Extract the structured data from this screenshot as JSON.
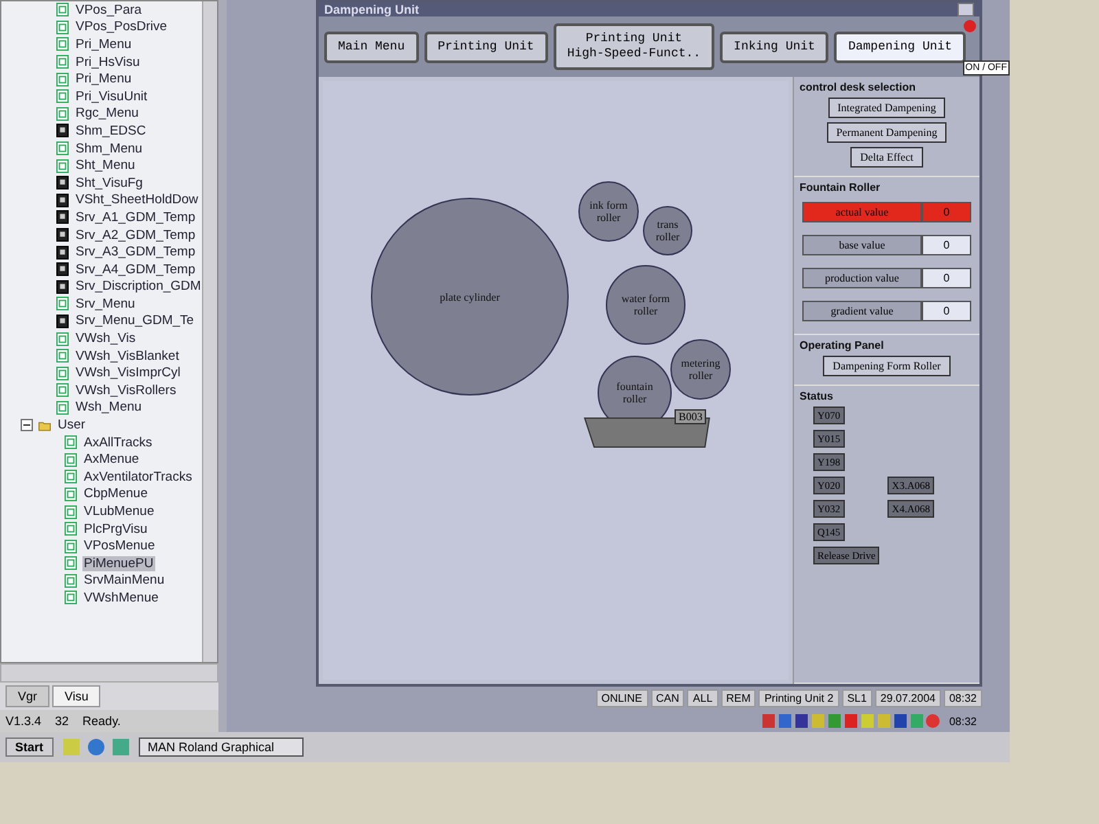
{
  "tree": {
    "items": [
      {
        "label": "VPos_Para",
        "kind": "doc",
        "selected": false
      },
      {
        "label": "VPos_PosDrive",
        "kind": "doc",
        "selected": false
      },
      {
        "label": "Pri_Menu",
        "kind": "doc",
        "selected": false
      },
      {
        "label": "Pri_HsVisu",
        "kind": "doc",
        "selected": false
      },
      {
        "label": "Pri_Menu",
        "kind": "doc",
        "selected": false
      },
      {
        "label": "Pri_VisuUnit",
        "kind": "doc",
        "selected": false
      },
      {
        "label": "Rgc_Menu",
        "kind": "doc",
        "selected": false
      },
      {
        "label": "Shm_EDSC",
        "kind": "module",
        "selected": false
      },
      {
        "label": "Shm_Menu",
        "kind": "doc",
        "selected": false
      },
      {
        "label": "Sht_Menu",
        "kind": "doc",
        "selected": false
      },
      {
        "label": "Sht_VisuFg",
        "kind": "module",
        "selected": false
      },
      {
        "label": "VSht_SheetHoldDow",
        "kind": "module",
        "selected": false
      },
      {
        "label": "Srv_A1_GDM_Temp",
        "kind": "module",
        "selected": false
      },
      {
        "label": "Srv_A2_GDM_Temp",
        "kind": "module",
        "selected": false
      },
      {
        "label": "Srv_A3_GDM_Temp",
        "kind": "module",
        "selected": false
      },
      {
        "label": "Srv_A4_GDM_Temp",
        "kind": "module",
        "selected": false
      },
      {
        "label": "Srv_Discription_GDM",
        "kind": "module",
        "selected": false
      },
      {
        "label": "Srv_Menu",
        "kind": "doc",
        "selected": false
      },
      {
        "label": "Srv_Menu_GDM_Te",
        "kind": "module",
        "selected": false
      },
      {
        "label": "VWsh_Vis",
        "kind": "doc",
        "selected": false
      },
      {
        "label": "VWsh_VisBlanket",
        "kind": "doc",
        "selected": false
      },
      {
        "label": "VWsh_VisImprCyl",
        "kind": "doc",
        "selected": false
      },
      {
        "label": "VWsh_VisRollers",
        "kind": "doc",
        "selected": false
      },
      {
        "label": "Wsh_Menu",
        "kind": "doc",
        "selected": false
      },
      {
        "label": "User",
        "kind": "folder",
        "expanded": true,
        "selected": false,
        "children": [
          {
            "label": "AxAllTracks",
            "kind": "doc",
            "selected": false
          },
          {
            "label": "AxMenue",
            "kind": "doc",
            "selected": false
          },
          {
            "label": "AxVentilatorTracks",
            "kind": "doc",
            "selected": false
          },
          {
            "label": "CbpMenue",
            "kind": "doc",
            "selected": false
          },
          {
            "label": "VLubMenue",
            "kind": "doc",
            "selected": false
          },
          {
            "label": "PlcPrgVisu",
            "kind": "doc",
            "selected": false
          },
          {
            "label": "VPosMenue",
            "kind": "doc",
            "selected": false
          },
          {
            "label": "PiMenuePU",
            "kind": "doc",
            "selected": true
          },
          {
            "label": "SrvMainMenu",
            "kind": "doc",
            "selected": false
          },
          {
            "label": "VWshMenue",
            "kind": "doc",
            "selected": false
          }
        ]
      }
    ]
  },
  "left_tabs": [
    {
      "label": "Vgr",
      "selected": false
    },
    {
      "label": "Visu",
      "selected": true
    }
  ],
  "left_status": [
    "V1.3.4",
    "32",
    "Ready."
  ],
  "window": {
    "title": "Dampening Unit",
    "tabs": [
      {
        "label": "Main Menu",
        "selected": false
      },
      {
        "label": "Printing Unit",
        "selected": false
      },
      {
        "label": "Printing Unit\nHigh-Speed-Funct..",
        "selected": false
      },
      {
        "label": "Inking Unit",
        "selected": false
      },
      {
        "label": "Dampening Unit",
        "selected": true
      }
    ],
    "toggle": "ON / OFF"
  },
  "diagram": {
    "rollers": [
      {
        "label": "plate cylinder"
      },
      {
        "label": "ink form roller"
      },
      {
        "label": "trans roller"
      },
      {
        "label": "water form roller"
      },
      {
        "label": "metering roller"
      },
      {
        "label": "fountain roller"
      }
    ],
    "tray_label": "B003"
  },
  "panel": {
    "control_desk": {
      "title": "control desk selection",
      "buttons": [
        "Integrated Dampening",
        "Permanent Dampening",
        "Delta Effect"
      ]
    },
    "fountain_roller": {
      "title": "Fountain Roller",
      "values": [
        {
          "label": "actual value",
          "value": "0",
          "alarm": true
        },
        {
          "label": "base value",
          "value": "0",
          "alarm": false
        },
        {
          "label": "production value",
          "value": "0",
          "alarm": false
        },
        {
          "label": "gradient value",
          "value": "0",
          "alarm": false
        }
      ]
    },
    "operating_panel": {
      "title": "Operating Panel",
      "buttons": [
        "Dampening Form Roller"
      ]
    },
    "status": {
      "title": "Status",
      "items": [
        "Y070",
        "Y015",
        "Y198",
        "Y020",
        "X3.A068",
        "Y032",
        "X4.A068",
        "Q145",
        "Release Drive"
      ]
    }
  },
  "status_bar": [
    "ONLINE",
    "CAN",
    "ALL",
    "REM",
    "Printing Unit 2",
    "SL1",
    "29.07.2004",
    "08:32"
  ],
  "taskbar": {
    "start": "Start",
    "tasks": [
      "MAN Roland Graphical"
    ],
    "clock": "08:32"
  }
}
